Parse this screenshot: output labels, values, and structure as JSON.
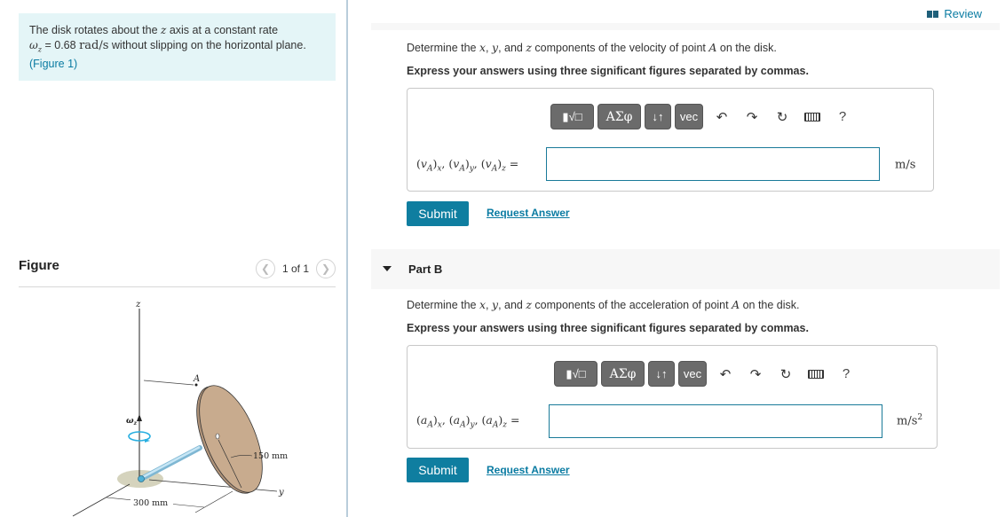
{
  "problem": {
    "text_1": "The disk rotates about the ",
    "z_var": "z",
    "text_2": " axis at a constant rate",
    "omega_symbol": "ω",
    "omega_sub": "z",
    "equals": " = 0.68 ",
    "unit": "rad/s",
    "text_3": " without slipping on the horizontal plane. ",
    "figure_link": "(Figure 1)"
  },
  "figure_panel": {
    "title": "Figure",
    "pager_text": "1 of 1",
    "prev_icon": "chevron-left",
    "next_icon": "chevron-right",
    "labels": {
      "z_axis": "z",
      "y_axis": "y",
      "point": "A",
      "omega": "ω",
      "omega_sub": "z",
      "radius": "150 mm",
      "length": "300 mm"
    }
  },
  "header": {
    "review_label": "Review",
    "review_icon": "book-icon"
  },
  "part_a": {
    "prompt_1": "Determine the ",
    "x": "x",
    "sep1": ", ",
    "y": "y",
    "sep2": ", and ",
    "z": "z",
    "prompt_2": " components of the velocity of point ",
    "point": "A",
    "prompt_3": " on the disk.",
    "instruction": "Express your answers using three significant figures separated by commas.",
    "toolbar": {
      "template_label": "▮√□",
      "greek_label": "ΑΣφ",
      "arrows_label": "↓↑",
      "vec_label": "vec",
      "help_label": "?"
    },
    "eq_var": "v",
    "eq_sub": "A",
    "components": [
      "x",
      "y",
      "z"
    ],
    "input_value": "",
    "unit": "m/s",
    "unit_sup": "",
    "submit_label": "Submit",
    "request_label": "Request Answer"
  },
  "part_b": {
    "label": "Part B",
    "prompt_1": "Determine the ",
    "x": "x",
    "sep1": ", ",
    "y": "y",
    "sep2": ", and ",
    "z": "z",
    "prompt_2": " components of the acceleration of point ",
    "point": "A",
    "prompt_3": " on the disk.",
    "instruction": "Express your answers using three significant figures separated by commas.",
    "toolbar": {
      "template_label": "▮√□",
      "greek_label": "ΑΣφ",
      "arrows_label": "↓↑",
      "vec_label": "vec",
      "help_label": "?"
    },
    "eq_var": "a",
    "eq_sub": "A",
    "components": [
      "x",
      "y",
      "z"
    ],
    "input_value": "",
    "unit": "m/s",
    "unit_sup": "2",
    "submit_label": "Submit",
    "request_label": "Request Answer"
  },
  "colors": {
    "accent": "#0f7ea0",
    "link": "#0a7ba2",
    "problem_bg": "#e4f5f7",
    "disk_fill": "#c8ab8e",
    "rod": "#a9d3ea",
    "rotation_arrow": "#27aee0"
  }
}
